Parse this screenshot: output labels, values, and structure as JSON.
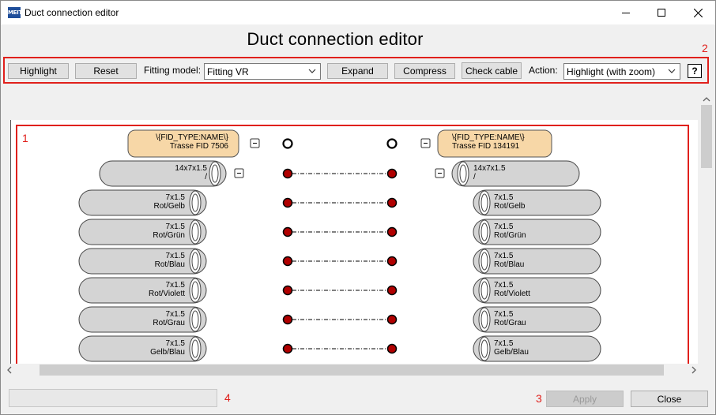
{
  "window": {
    "title": "Duct connection editor",
    "app_icon_text": "MEIT"
  },
  "header": {
    "title": "Duct connection editor"
  },
  "toolbar": {
    "highlight_label": "Highlight",
    "reset_label": "Reset",
    "fitting_model_label": "Fitting model:",
    "fitting_model_value": "Fitting VR",
    "expand_label": "Expand",
    "compress_label": "Compress",
    "check_cable_label": "Check cable",
    "action_label": "Action:",
    "action_value": "Highlight (with zoom)",
    "help_label": "?"
  },
  "annotations": {
    "n1": "1",
    "n2": "2",
    "n3": "3",
    "n4": "4"
  },
  "diagram": {
    "left_trasse": {
      "type": "\\{FID_TYPE:NAME\\}",
      "name": "Trasse FID 7506"
    },
    "right_trasse": {
      "type": "\\{FID_TYPE:NAME\\}",
      "name": "Trasse FID 134191"
    },
    "collapse_symbol": "-",
    "left_duct": {
      "size": "14x7x1.5",
      "sub": "/"
    },
    "right_duct": {
      "size": "14x7x1.5",
      "sub": "/"
    },
    "tubes": [
      {
        "size": "7x1.5",
        "color": "Rot/Gelb"
      },
      {
        "size": "7x1.5",
        "color": "Rot/Grün"
      },
      {
        "size": "7x1.5",
        "color": "Rot/Blau"
      },
      {
        "size": "7x1.5",
        "color": "Rot/Violett"
      },
      {
        "size": "7x1.5",
        "color": "Rot/Grau"
      },
      {
        "size": "7x1.5",
        "color": "Gelb/Blau"
      }
    ]
  },
  "footer": {
    "apply_label": "Apply",
    "close_label": "Close"
  },
  "colors": {
    "accent_red": "#e0201c",
    "trasse_fill": "#f7d7a7",
    "tube_fill": "#d4d4d4",
    "connector_red": "#b00000"
  }
}
